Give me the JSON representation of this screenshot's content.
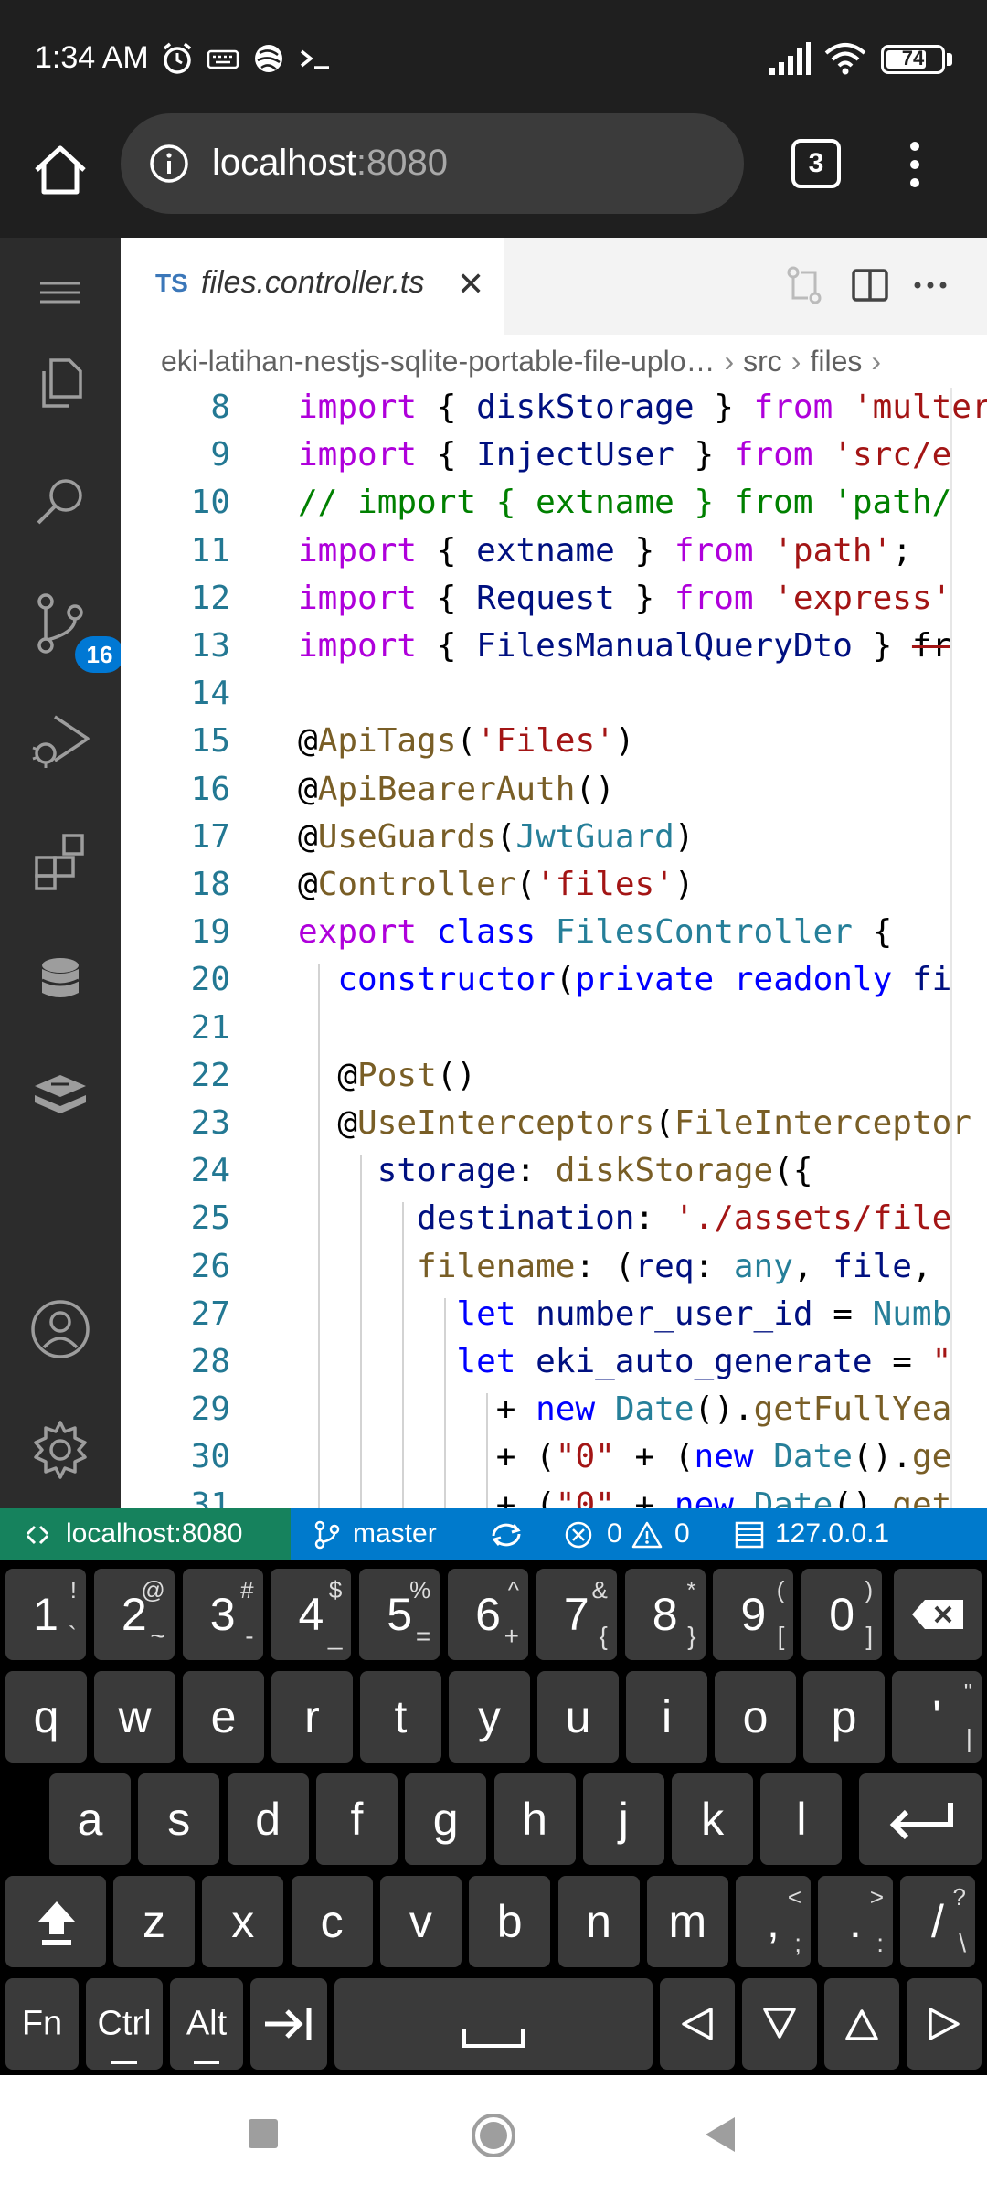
{
  "status": {
    "time": "1:34 AM",
    "battery": "74",
    "battery_level": 0.74
  },
  "browser": {
    "url_host": "localhost",
    "url_port": ":8080",
    "tab_count": "3"
  },
  "activity": {
    "scm_badge": "16"
  },
  "editor": {
    "tab_lang": "TS",
    "tab_name": "files.controller.ts",
    "tab_close": "✕",
    "breadcrumb": [
      "eki-latihan-nestjs-sqlite-portable-file-uplo…",
      "src",
      "files"
    ],
    "lines": [
      {
        "n": "8",
        "html": "<span class='k'>import</span> <span class='p'>{ </span><span class='v'>diskStorage</span><span class='p'> } </span><span class='k'>from</span> <span class='s'>'multer';</span>"
      },
      {
        "n": "9",
        "html": "<span class='k'>import</span> <span class='p'>{ </span><span class='v'>InjectUser</span><span class='p'> } </span><span class='k'>from</span> <span class='s'>'src/e</span>"
      },
      {
        "n": "10",
        "html": "<span class='c'>// import { extname } from 'path/</span>"
      },
      {
        "n": "11",
        "html": "<span class='k'>import</span> <span class='p'>{ </span><span class='v'>extname</span><span class='p'> } </span><span class='k'>from</span> <span class='s'>'path'</span><span class='p'>;</span>"
      },
      {
        "n": "12",
        "html": "<span class='k'>import</span> <span class='p'>{ </span><span class='v'>Request</span><span class='p'> } </span><span class='k'>from</span> <span class='s'>'express'</span>"
      },
      {
        "n": "13",
        "html": "<span class='k'>import</span> <span class='p'>{ </span><span class='v'>FilesManualQueryDto</span><span class='p'> } </span><span class='st'>fr</span>"
      },
      {
        "n": "14",
        "html": ""
      },
      {
        "n": "15",
        "html": "<span class='p'>@</span><span class='d'>ApiTags</span><span class='p'>(</span><span class='s'>'Files'</span><span class='p'>)</span>"
      },
      {
        "n": "16",
        "html": "<span class='p'>@</span><span class='d'>ApiBearerAuth</span><span class='p'>()</span>"
      },
      {
        "n": "17",
        "html": "<span class='p'>@</span><span class='d'>UseGuards</span><span class='p'>(</span><span class='t'>JwtGuard</span><span class='p'>)</span>"
      },
      {
        "n": "18",
        "html": "<span class='p'>@</span><span class='d'>Controller</span><span class='p'>(</span><span class='s'>'files'</span><span class='p'>)</span>"
      },
      {
        "n": "19",
        "html": "<span class='k'>export</span> <span class='b'>class</span> <span class='t'>FilesController</span><span class='p'> {</span>"
      },
      {
        "n": "20",
        "html": "  <span class='b'>constructor</span><span class='p'>(</span><span class='b'>private</span> <span class='b'>readonly</span> <span class='v'>fi</span>"
      },
      {
        "n": "21",
        "html": ""
      },
      {
        "n": "22",
        "html": "  <span class='p'>@</span><span class='d'>Post</span><span class='p'>()</span>"
      },
      {
        "n": "23",
        "html": "  <span class='p'>@</span><span class='d'>UseInterceptors</span><span class='p'>(</span><span class='d'>FileInterceptor</span>"
      },
      {
        "n": "24",
        "html": "    <span class='v'>storage</span><span class='p'>: </span><span class='d'>diskStorage</span><span class='p'>({</span>"
      },
      {
        "n": "25",
        "html": "      <span class='v'>destination</span><span class='p'>: </span><span class='s'>'./assets/file</span>"
      },
      {
        "n": "26",
        "html": "      <span class='d'>filename</span><span class='p'>: (</span><span class='v'>req</span><span class='p'>: </span><span class='t'>any</span><span class='p'>, </span><span class='v'>file</span><span class='p'>,</span>"
      },
      {
        "n": "27",
        "html": "        <span class='b'>let</span> <span class='v'>number_user_id</span><span class='p'> = </span><span class='t'>Numb</span>"
      },
      {
        "n": "28",
        "html": "        <span class='b'>let</span> <span class='v'>eki_auto_generate</span><span class='p'> = </span><span class='s'>\"</span>"
      },
      {
        "n": "29",
        "html": "          <span class='p'>+ </span><span class='b'>new</span> <span class='t'>Date</span><span class='p'>().</span><span class='d'>getFullYea</span>"
      },
      {
        "n": "30",
        "html": "          <span class='p'>+ (</span><span class='s'>\"0\"</span><span class='p'> + (</span><span class='b'>new</span> <span class='t'>Date</span><span class='p'>().</span><span class='d'>ge</span>"
      },
      {
        "n": "31",
        "html": "          <span class='p'>+ (</span><span class='s'>\"0\"</span><span class='p'> + </span><span class='b'>new</span> <span class='t'>Date</span><span class='p'>().</span><span class='d'>get</span>"
      }
    ]
  },
  "vstatus": {
    "remote": "localhost:8080",
    "branch": "master",
    "errors": "0",
    "warnings": "0",
    "port": "127.0.0.1"
  },
  "keyboard": {
    "row1": [
      {
        "m": "1",
        "a": "!",
        "a2": "`"
      },
      {
        "m": "2",
        "a": "@",
        "a2": "~"
      },
      {
        "m": "3",
        "a": "#",
        "a2": "-"
      },
      {
        "m": "4",
        "a": "$",
        "a2": "_"
      },
      {
        "m": "5",
        "a": "%",
        "a2": "="
      },
      {
        "m": "6",
        "a": "^",
        "a2": "+"
      },
      {
        "m": "7",
        "a": "&",
        "a2": "{"
      },
      {
        "m": "8",
        "a": "*",
        "a2": "}"
      },
      {
        "m": "9",
        "a": "(",
        "a2": "["
      },
      {
        "m": "0",
        "a": ")",
        "a2": "]"
      }
    ],
    "row2": [
      "q",
      "w",
      "e",
      "r",
      "t",
      "y",
      "u",
      "i",
      "o",
      "p"
    ],
    "row2_extra": {
      "m": "'",
      "a": "\"",
      "a2": "|"
    },
    "row3": [
      "a",
      "s",
      "d",
      "f",
      "g",
      "h",
      "j",
      "k",
      "l"
    ],
    "row4": [
      "z",
      "x",
      "c",
      "v",
      "b",
      "n",
      "m"
    ],
    "row4_punct": [
      {
        "m": ",",
        "a": "<",
        "a2": ";"
      },
      {
        "m": ".",
        "a": ">",
        "a2": ":"
      },
      {
        "m": "/",
        "a": "?",
        "a2": "\\"
      }
    ],
    "fn": "Fn",
    "ctrl": "Ctrl",
    "alt": "Alt"
  }
}
